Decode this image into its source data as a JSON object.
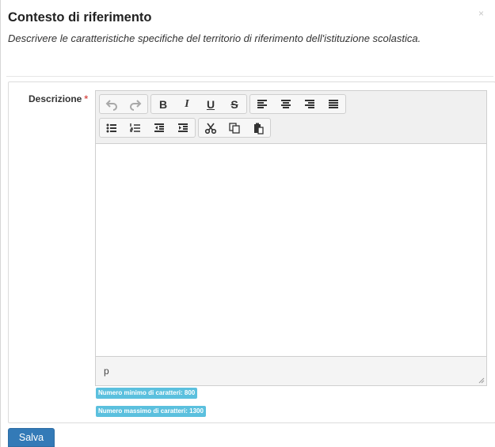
{
  "header": {
    "title": "Contesto di riferimento",
    "subtitle": "Descrivere le caratteristiche specifiche del territorio di riferimento dell'istituzione scolastica.",
    "close_symbol": "×"
  },
  "form": {
    "field_label": "Descrizione",
    "required_marker": "*",
    "editor": {
      "toolbar_row1": [
        "undo-icon",
        "redo-icon",
        "bold-icon",
        "italic-icon",
        "underline-icon",
        "strikethrough-icon",
        "align-left-icon",
        "align-center-icon",
        "align-right-icon",
        "align-justify-icon"
      ],
      "toolbar_row2": [
        "bullet-list-icon",
        "numbered-list-icon",
        "outdent-icon",
        "indent-icon",
        "cut-icon",
        "copy-icon",
        "paste-icon"
      ],
      "content": "",
      "path": "p"
    },
    "min_chars_badge": "Numero minimo di caratteri: 800",
    "max_chars_badge": "Numero massimo di caratteri: 1300"
  },
  "actions": {
    "save_label": "Salva"
  },
  "colors": {
    "accent": "#337ab7",
    "badge": "#5bc0de",
    "required": "#d9534f"
  }
}
